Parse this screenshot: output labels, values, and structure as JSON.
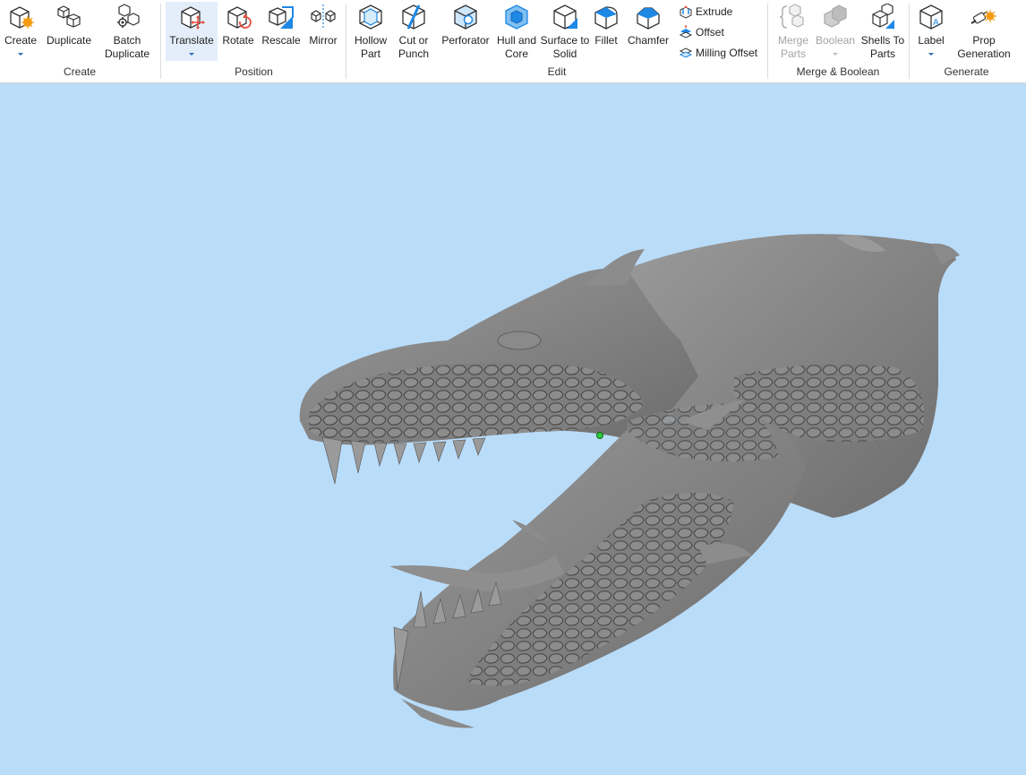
{
  "ribbon": {
    "groups": {
      "create": {
        "label": "Create",
        "buttons": {
          "create": "Create",
          "duplicate": "Duplicate",
          "batch_duplicate": "Batch\nDuplicate"
        }
      },
      "position": {
        "label": "Position",
        "buttons": {
          "translate": "Translate",
          "rotate": "Rotate",
          "rescale": "Rescale",
          "mirror": "Mirror"
        }
      },
      "edit": {
        "label": "Edit",
        "buttons": {
          "hollow_part": "Hollow\nPart",
          "cut_or_punch": "Cut or\nPunch",
          "perforator": "Perforator",
          "hull_and_core": "Hull and\nCore",
          "surface_to_solid": "Surface to\nSolid",
          "fillet": "Fillet",
          "chamfer": "Chamfer",
          "extrude": "Extrude",
          "offset": "Offset",
          "milling_offset": "Milling Offset"
        }
      },
      "merge_boolean": {
        "label": "Merge & Boolean",
        "buttons": {
          "merge_parts": "Merge\nParts",
          "boolean": "Boolean",
          "shells_to_parts": "Shells To\nParts"
        }
      },
      "generate": {
        "label": "Generate",
        "buttons": {
          "label": "Label",
          "prop_generation": "Prop\nGeneration"
        }
      }
    },
    "colors": {
      "accent_blue": "#1e88e5",
      "accent_orange": "#f39c12",
      "accent_red": "#e74c3c",
      "disabled": "#a3a3a3"
    }
  },
  "viewport": {
    "background": "#b9dcf9",
    "model_color": "#7d7d7d",
    "icon_names": [
      "model-mesh",
      "selection-point"
    ]
  }
}
